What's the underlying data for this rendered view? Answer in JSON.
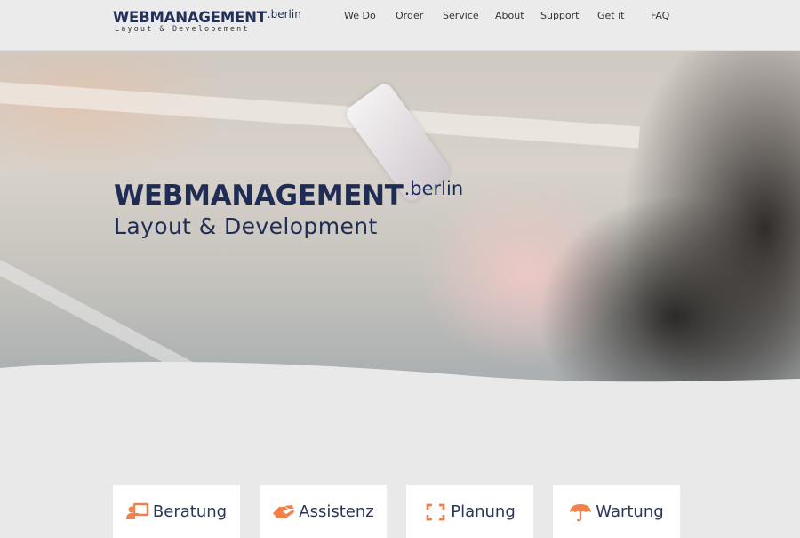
{
  "brand": {
    "name": "WEBMANAGEMENT",
    "tld": ".berlin",
    "tagline": "Layout & Developement"
  },
  "nav": {
    "items": [
      {
        "label": "We Do"
      },
      {
        "label": "Order"
      },
      {
        "label": "Service"
      },
      {
        "label": "About"
      },
      {
        "label": "Support"
      },
      {
        "label": "Get it"
      },
      {
        "label": "FAQ"
      }
    ]
  },
  "hero": {
    "title": "WEBMANAGEMENT",
    "tld": ".berlin",
    "subtitle": "Layout & Development",
    "image_description": "woman holding smartphone"
  },
  "services": [
    {
      "label": "Beratung",
      "icon": "presentation-icon"
    },
    {
      "label": "Assistenz",
      "icon": "handshake-icon"
    },
    {
      "label": "Planung",
      "icon": "expand-icon"
    },
    {
      "label": "Wartung",
      "icon": "umbrella-icon"
    }
  ],
  "colors": {
    "brand_navy": "#22305a",
    "accent_orange": "#f0814a",
    "page_bg": "#e9e9e9"
  }
}
